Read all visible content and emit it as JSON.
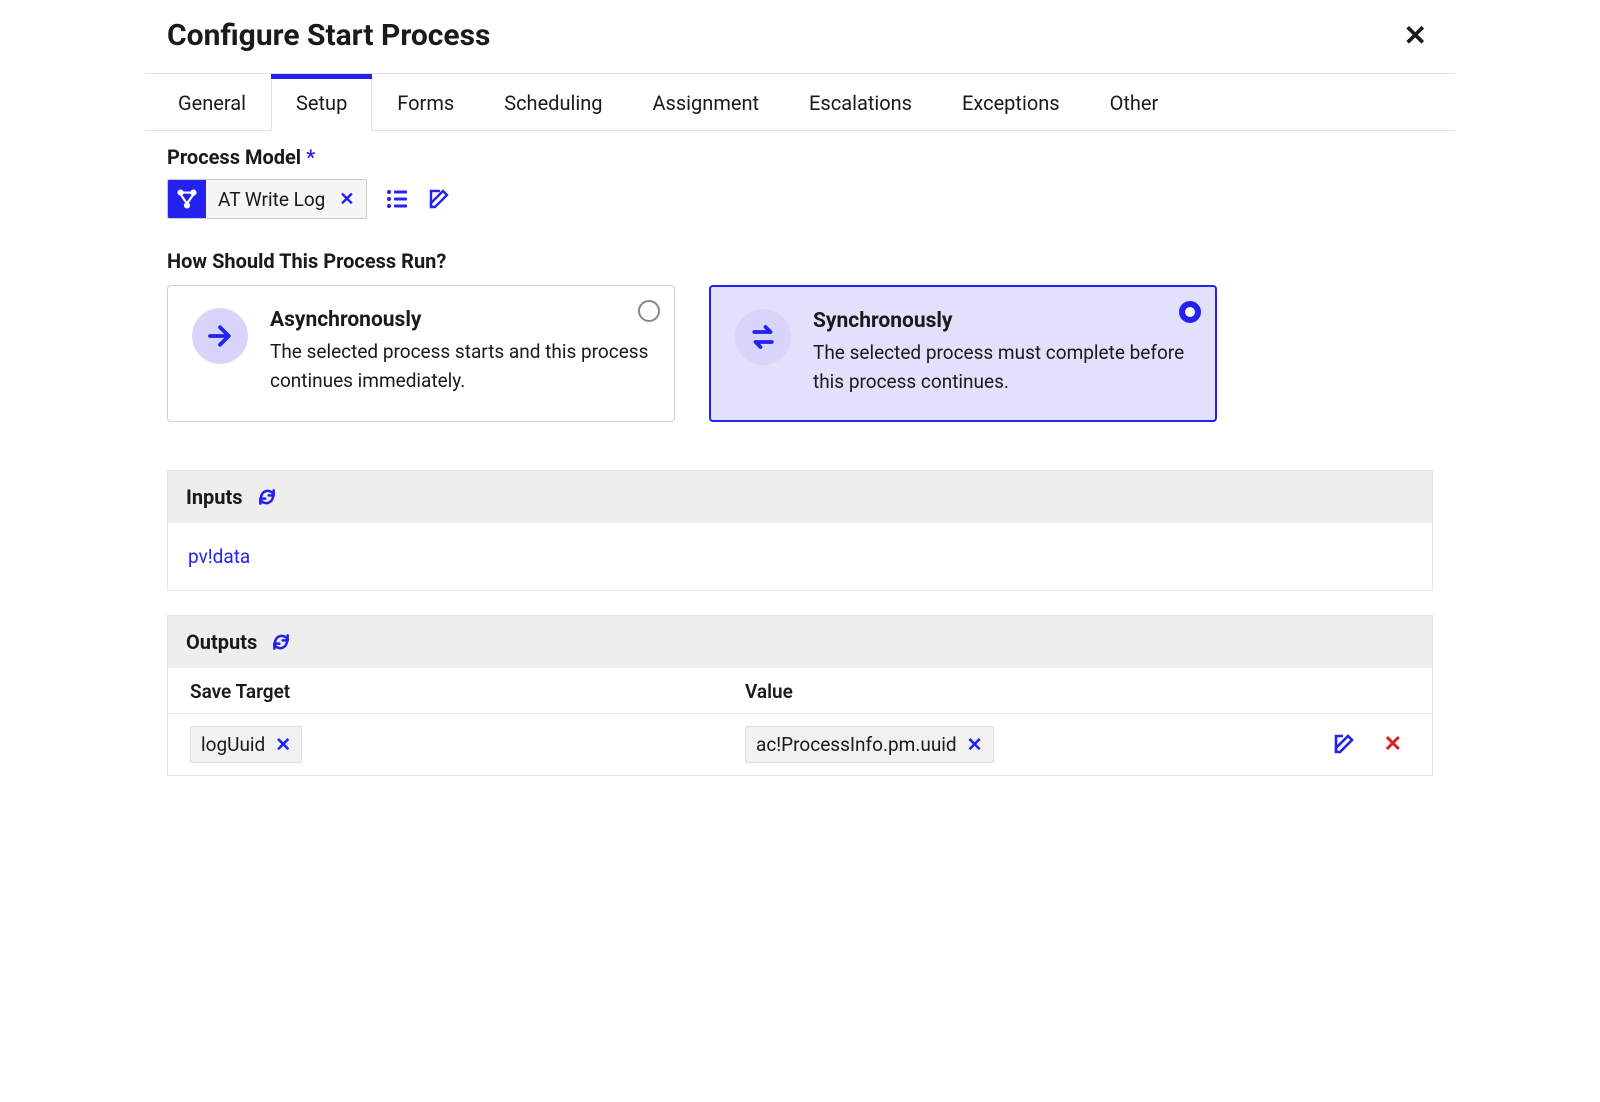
{
  "dialog": {
    "title": "Configure Start Process"
  },
  "tabs": [
    {
      "label": "General",
      "active": false
    },
    {
      "label": "Setup",
      "active": true
    },
    {
      "label": "Forms",
      "active": false
    },
    {
      "label": "Scheduling",
      "active": false
    },
    {
      "label": "Assignment",
      "active": false
    },
    {
      "label": "Escalations",
      "active": false
    },
    {
      "label": "Exceptions",
      "active": false
    },
    {
      "label": "Other",
      "active": false
    }
  ],
  "process_model": {
    "label": "Process Model",
    "required_marker": "*",
    "value": "AT Write Log"
  },
  "run_mode": {
    "heading": "How Should This Process Run?",
    "async": {
      "title": "Asynchronously",
      "desc": "The selected process starts and this process continues immediately.",
      "selected": false
    },
    "sync": {
      "title": "Synchronously",
      "desc": "The selected process must complete before this process continues.",
      "selected": true
    }
  },
  "inputs": {
    "heading": "Inputs",
    "items": [
      "pv!data"
    ]
  },
  "outputs": {
    "heading": "Outputs",
    "columns": {
      "save_target": "Save Target",
      "value": "Value"
    },
    "rows": [
      {
        "save_target": "logUuid",
        "value": "ac!ProcessInfo.pm.uuid"
      }
    ]
  }
}
